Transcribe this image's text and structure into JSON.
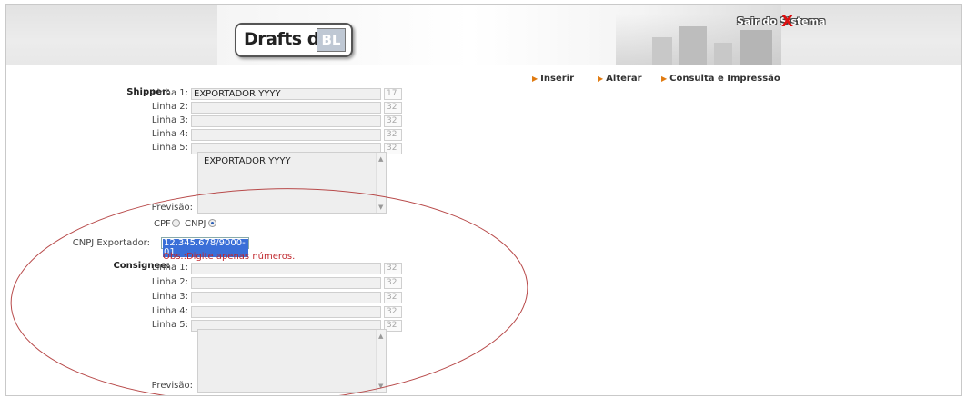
{
  "header": {
    "logo_text": "Drafts de",
    "logo_badge": "BL",
    "logout_label": "Sair do Sistema",
    "logout_icon": "X"
  },
  "nav": [
    {
      "label": "Inserir"
    },
    {
      "label": "Alterar"
    },
    {
      "label": "Consulta e Impressão"
    }
  ],
  "shipper": {
    "section_label": "Shipper:",
    "lines": [
      {
        "label": "Linha 1:",
        "value": "EXPORTADOR YYYY",
        "count": "17"
      },
      {
        "label": "Linha 2:",
        "value": "",
        "count": "32"
      },
      {
        "label": "Linha 3:",
        "value": "",
        "count": "32"
      },
      {
        "label": "Linha 4:",
        "value": "",
        "count": "32"
      },
      {
        "label": "Linha 5:",
        "value": "",
        "count": "32"
      }
    ],
    "preview_label": "Previsão:",
    "preview_text": "EXPORTADOR YYYY"
  },
  "doc_type": {
    "cpf_label": "CPF",
    "cnpj_label": "CNPJ",
    "selected": "CNPJ"
  },
  "cnpj": {
    "label": "CNPJ Exportador:",
    "value": "12.345.678/9000-01",
    "hint": "Obs.:Digite apenas números."
  },
  "consignee": {
    "section_label": "Consignee:",
    "lines": [
      {
        "label": "Linha 1:",
        "value": "",
        "count": "32"
      },
      {
        "label": "Linha 2:",
        "value": "",
        "count": "32"
      },
      {
        "label": "Linha 3:",
        "value": "",
        "count": "32"
      },
      {
        "label": "Linha 4:",
        "value": "",
        "count": "32"
      },
      {
        "label": "Linha 5:",
        "value": "",
        "count": "32"
      }
    ],
    "preview_label": "Previsão:",
    "preview_text": ""
  },
  "colors": {
    "accent_arrow": "#e07a10",
    "hint_text": "#c0272d",
    "annotation_ellipse": "#b84a4a"
  }
}
